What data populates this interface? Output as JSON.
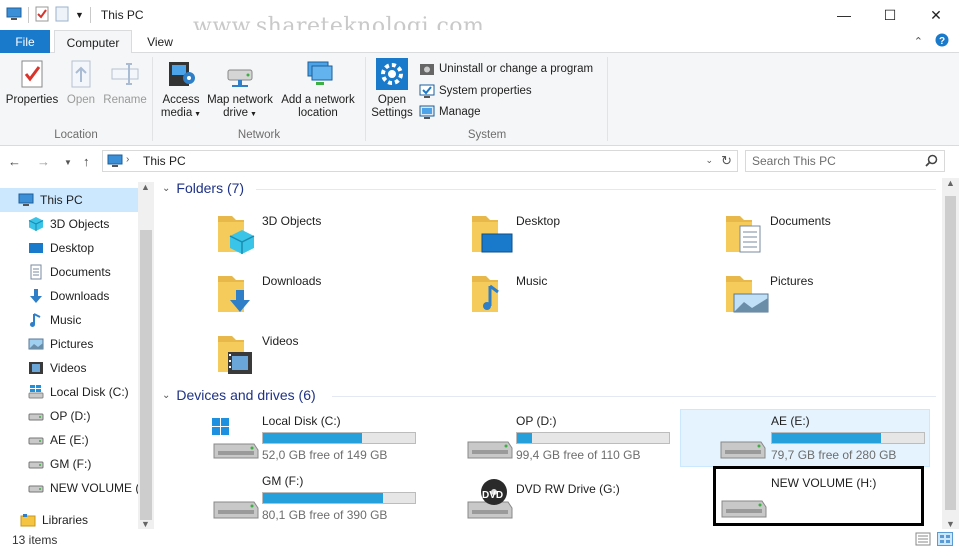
{
  "window": {
    "title": "This PC",
    "watermark": "www.shareteknologi.com"
  },
  "tabs": {
    "file": "File",
    "computer": "Computer",
    "view": "View"
  },
  "ribbon": {
    "location": {
      "label": "Location",
      "properties": "Properties",
      "open": "Open",
      "rename": "Rename"
    },
    "network": {
      "label": "Network",
      "access_media": "Access media",
      "map_drive": "Map network drive",
      "add_location": "Add a network location"
    },
    "system": {
      "label": "System",
      "open_settings": "Open Settings",
      "uninstall": "Uninstall or change a program",
      "system_properties": "System properties",
      "manage": "Manage"
    }
  },
  "address": {
    "path": "This PC",
    "search_placeholder": "Search This PC"
  },
  "sidebar": {
    "items": [
      {
        "label": "This PC",
        "icon": "pc-icon"
      },
      {
        "label": "3D Objects",
        "icon": "cube-icon"
      },
      {
        "label": "Desktop",
        "icon": "desktop-icon"
      },
      {
        "label": "Documents",
        "icon": "document-icon"
      },
      {
        "label": "Downloads",
        "icon": "download-icon"
      },
      {
        "label": "Music",
        "icon": "music-icon"
      },
      {
        "label": "Pictures",
        "icon": "picture-icon"
      },
      {
        "label": "Videos",
        "icon": "video-icon"
      },
      {
        "label": "Local Disk (C:)",
        "icon": "windows-drive-icon"
      },
      {
        "label": "OP (D:)",
        "icon": "drive-icon"
      },
      {
        "label": "AE (E:)",
        "icon": "drive-icon"
      },
      {
        "label": "GM (F:)",
        "icon": "drive-icon"
      },
      {
        "label": "NEW VOLUME (H:)",
        "icon": "drive-icon"
      },
      {
        "label": "Libraries",
        "icon": "libraries-icon"
      }
    ]
  },
  "folders": {
    "header": "Folders (7)",
    "items": [
      {
        "name": "3D Objects",
        "icon": "cube-icon"
      },
      {
        "name": "Desktop",
        "icon": "desktop-icon"
      },
      {
        "name": "Documents",
        "icon": "document-icon"
      },
      {
        "name": "Downloads",
        "icon": "download-icon"
      },
      {
        "name": "Music",
        "icon": "music-icon"
      },
      {
        "name": "Pictures",
        "icon": "picture-icon"
      },
      {
        "name": "Videos",
        "icon": "video-icon"
      }
    ]
  },
  "drives": {
    "header": "Devices and drives (6)",
    "items": [
      {
        "name": "Local Disk (C:)",
        "free": "52,0 GB free of 149 GB",
        "used_fraction": 0.65
      },
      {
        "name": "OP (D:)",
        "free": "99,4 GB free of 110 GB",
        "used_fraction": 0.1
      },
      {
        "name": "AE (E:)",
        "free": "79,7 GB free of 280 GB",
        "used_fraction": 0.72
      },
      {
        "name": "GM (F:)",
        "free": "80,1 GB free of 390 GB",
        "used_fraction": 0.79
      },
      {
        "name": "DVD RW Drive (G:)",
        "free": "",
        "dvd_label": "DVD"
      },
      {
        "name": "NEW VOLUME (H:)",
        "free": ""
      }
    ]
  },
  "status": {
    "count": "13 items"
  },
  "colors": {
    "accent": "#1979ca",
    "bar_fill": "#26a0da",
    "section_header": "#1e3287",
    "selected": "#cce8ff"
  }
}
